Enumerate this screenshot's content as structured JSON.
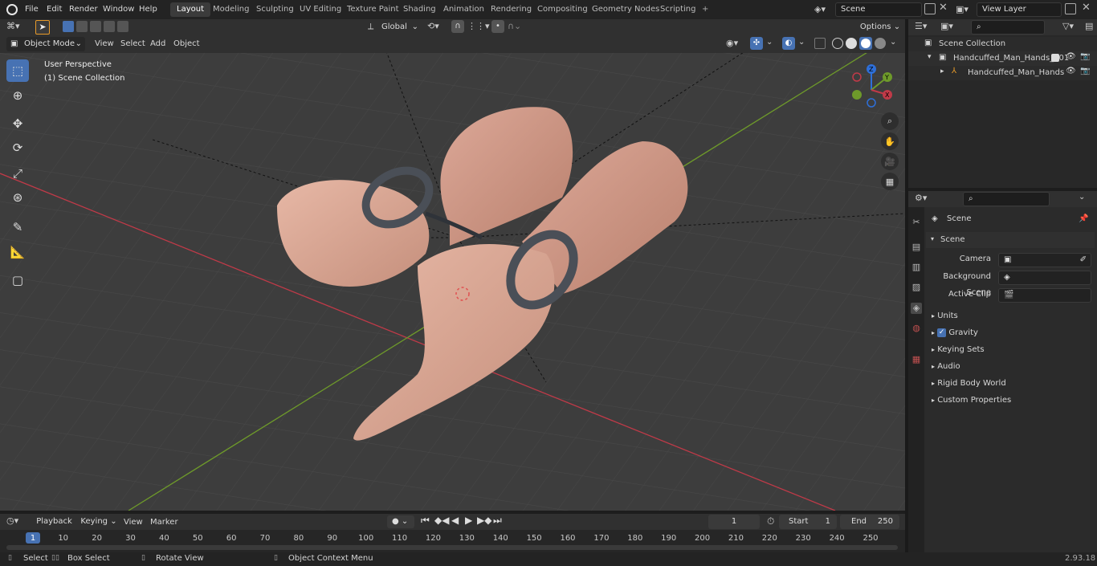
{
  "topbar": {
    "menus": [
      "File",
      "Edit",
      "Render",
      "Window",
      "Help"
    ],
    "workspaces": [
      "Layout",
      "Modeling",
      "Sculpting",
      "UV Editing",
      "Texture Paint",
      "Shading",
      "Animation",
      "Rendering",
      "Compositing",
      "Geometry Nodes",
      "Scripting"
    ],
    "active_workspace": "Layout",
    "add_tab": "+",
    "scene_name": "Scene",
    "view_layer": "View Layer"
  },
  "tool_header": {
    "orientation": "Global",
    "options": "Options"
  },
  "viewport_header": {
    "mode": "Object Mode",
    "menus": [
      "View",
      "Select",
      "Add",
      "Object"
    ]
  },
  "viewport": {
    "perspective_label": "User Perspective",
    "collection_label": "(1) Scene Collection",
    "gizmo_axes": {
      "z": "Z",
      "y": "Y",
      "x": "X"
    }
  },
  "outliner": {
    "root": "Scene Collection",
    "items": [
      {
        "label": "Handcuffed_Man_Hands_001",
        "level": 1
      },
      {
        "label": "Handcuffed_Man_Hands",
        "level": 2
      }
    ]
  },
  "properties": {
    "header": "Scene",
    "panel": "Scene",
    "fields": [
      {
        "label": "Camera",
        "value": ""
      },
      {
        "label": "Background Scene",
        "value": ""
      },
      {
        "label": "Active Clip",
        "value": ""
      }
    ],
    "sections": [
      "Units",
      "Gravity",
      "Keying Sets",
      "Audio",
      "Rigid Body World",
      "Custom Properties"
    ],
    "gravity_checked": true
  },
  "timeline": {
    "menus": [
      "Playback",
      "Keying",
      "View",
      "Marker"
    ],
    "current_frame": "1",
    "start_label": "Start",
    "start_value": "1",
    "end_label": "End",
    "end_value": "250",
    "ruler": [
      "1",
      "10",
      "20",
      "30",
      "40",
      "50",
      "60",
      "70",
      "80",
      "90",
      "100",
      "110",
      "120",
      "130",
      "140",
      "150",
      "160",
      "170",
      "180",
      "190",
      "200",
      "210",
      "220",
      "230",
      "240",
      "250"
    ]
  },
  "statusbar": {
    "select": "Select",
    "box_select": "Box Select",
    "rotate_view": "Rotate View",
    "context_menu": "Object Context Menu",
    "version": "2.93.18"
  },
  "colors": {
    "accent": "#4772b3",
    "x_axis": "#c03a48",
    "y_axis": "#6e9a2a",
    "skin": "#d9a894",
    "cuff": "#4a4f57"
  }
}
